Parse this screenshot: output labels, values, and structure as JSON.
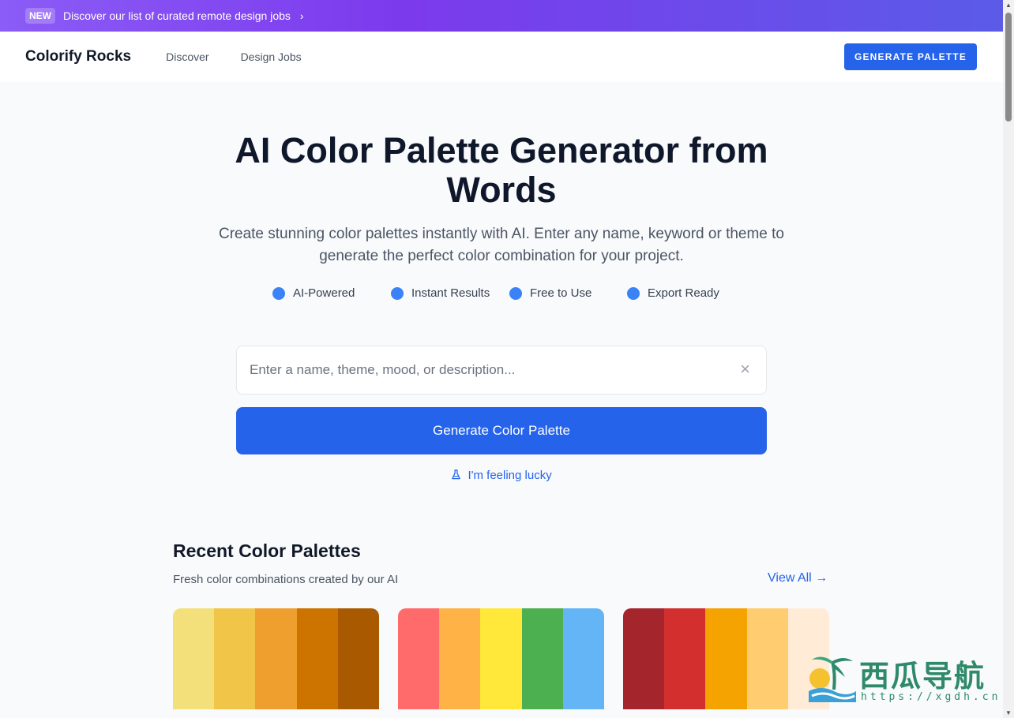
{
  "banner": {
    "badge": "NEW",
    "text": "Discover our list of curated remote design jobs",
    "chevron": "›"
  },
  "nav": {
    "brand": "Colorify Rocks",
    "links": [
      "Discover",
      "Design Jobs"
    ],
    "cta": "GENERATE PALETTE"
  },
  "hero": {
    "title_line1": "AI Color Palette Generator from",
    "title_line2": "Words",
    "subtitle": "Create stunning color palettes instantly with AI. Enter any name, keyword or theme to generate the perfect color combination for your project.",
    "features": [
      "AI-Powered",
      "Instant Results",
      "Free to Use",
      "Export Ready"
    ]
  },
  "search": {
    "placeholder": "Enter a name, theme, mood, or description...",
    "value": "",
    "clear_icon": "×"
  },
  "generate_button": "Generate Color Palette",
  "lucky": {
    "icon": "flask-icon",
    "label": "I'm feeling lucky"
  },
  "recent": {
    "title": "Recent Color Palettes",
    "subtitle": "Fresh color combinations created by our AI",
    "view_all": "View All →",
    "palettes": [
      [
        "#F4E07A",
        "#F1C547",
        "#EE9F2E",
        "#CC7300",
        "#A95A00"
      ],
      [
        "#FF6B6B",
        "#FFB347",
        "#FFE83A",
        "#4CAF50",
        "#64B5F6"
      ],
      [
        "#A4262C",
        "#D32F2F",
        "#F4A300",
        "#FFCC70",
        "#FFEBD6"
      ]
    ]
  },
  "watermark": {
    "text": "西瓜导航",
    "url": "https://xgdh.cn"
  },
  "colors": {
    "accent": "#2563eb",
    "feature_dot": "#3b82f6",
    "banner_start": "#8b5cf6",
    "banner_end": "#5b5be8"
  }
}
